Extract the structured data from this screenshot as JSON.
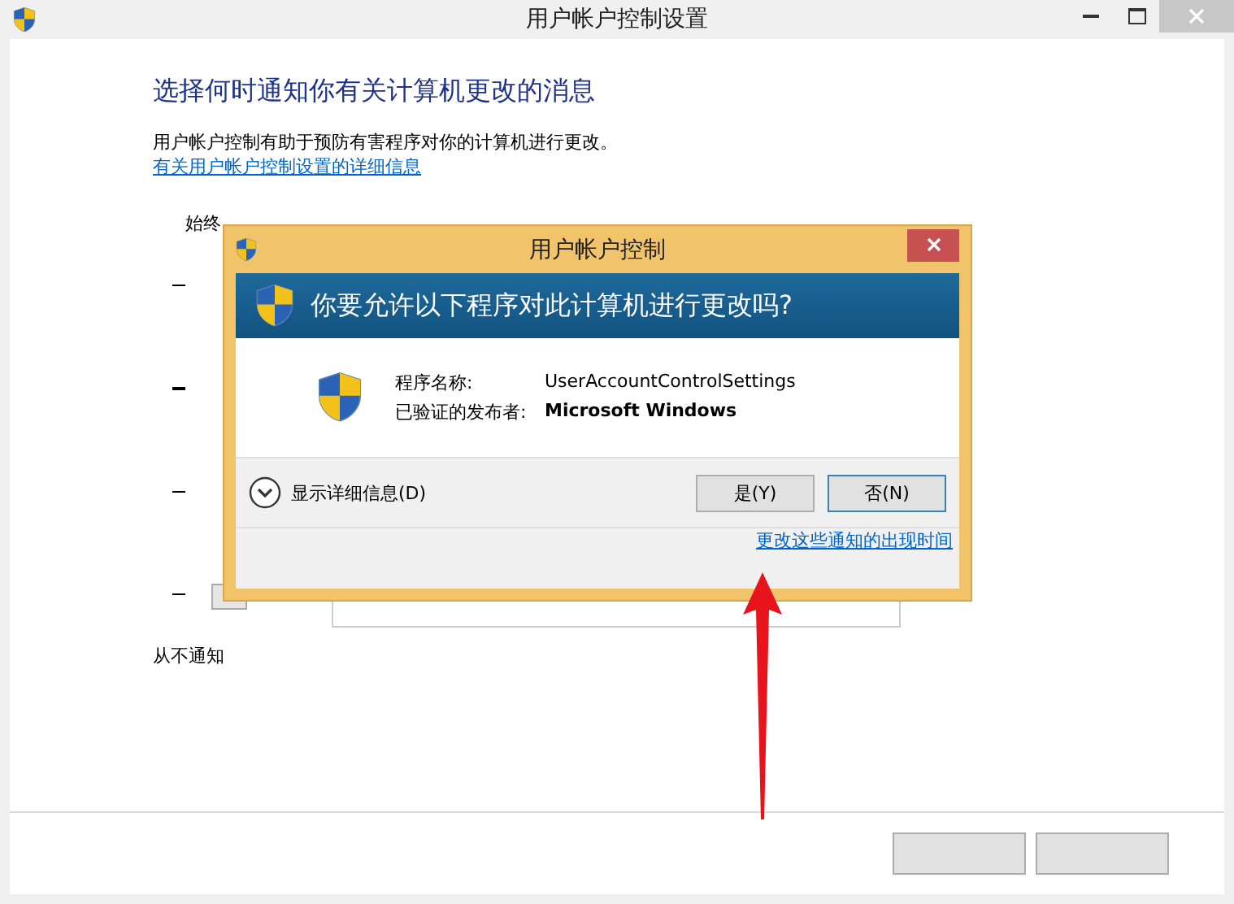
{
  "window": {
    "title": "用户帐户控制设置"
  },
  "heading": "选择何时通知你有关计算机更改的消息",
  "description": "用户帐户控制有助于预防有害程序对你的计算机进行更改。",
  "info_link": "有关用户帐户控制设置的详细信息",
  "slider": {
    "top_label": "始终",
    "bottom_label": "从不通知"
  },
  "dialog": {
    "title": "用户帐户控制",
    "question": "你要允许以下程序对此计算机进行更改吗?",
    "fields": [
      {
        "label": "程序名称:",
        "value": "UserAccountControlSettings",
        "bold": false
      },
      {
        "label": "已验证的发布者:",
        "value": "Microsoft Windows",
        "bold": true
      }
    ],
    "details": "显示详细信息(D)",
    "buttons": [
      {
        "label": "是(Y)",
        "focused": false
      },
      {
        "label": "否(N)",
        "focused": true
      }
    ],
    "link": "更改这些通知的出现时间"
  }
}
